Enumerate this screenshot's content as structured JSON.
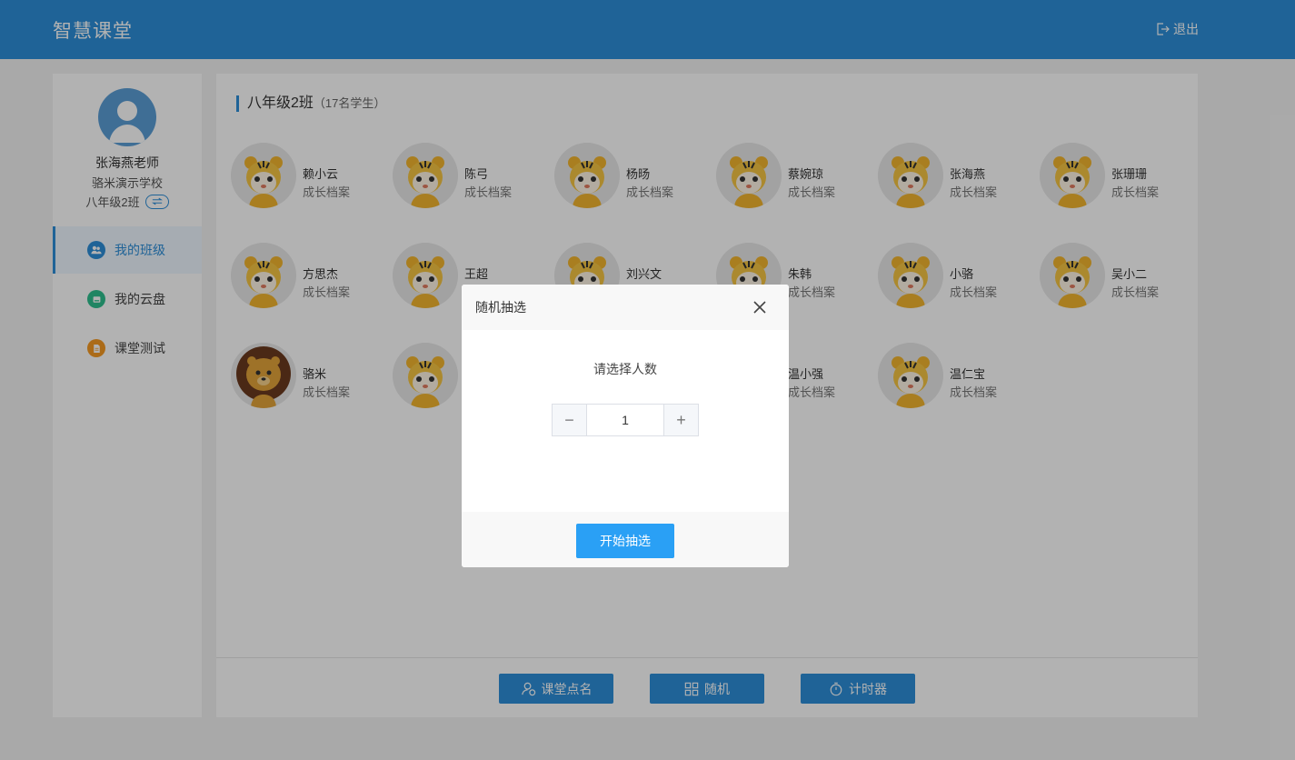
{
  "header": {
    "title": "智慧课堂",
    "logout_label": "退出"
  },
  "sidebar": {
    "teacher_name": "张海燕老师",
    "school_name": "骆米演示学校",
    "class_name": "八年级2班",
    "switch_icon": "swap-icon",
    "nav": [
      {
        "label": "我的班级",
        "icon": "users-icon",
        "color": "#2d8fd9",
        "active": true
      },
      {
        "label": "我的云盘",
        "icon": "cloud-drive-icon",
        "color": "#2fbf8f",
        "active": false
      },
      {
        "label": "课堂测试",
        "icon": "document-icon",
        "color": "#f59a23",
        "active": false
      }
    ]
  },
  "main": {
    "class_title": "八年级2班",
    "student_count": "（17名学生）",
    "students": [
      {
        "name": "赖小云",
        "link": "成长档案",
        "avatar": "tiger"
      },
      {
        "name": "陈弓",
        "link": "成长档案",
        "avatar": "tiger"
      },
      {
        "name": "杨旸",
        "link": "成长档案",
        "avatar": "tiger"
      },
      {
        "name": "蔡婉琼",
        "link": "成长档案",
        "avatar": "tiger"
      },
      {
        "name": "张海燕",
        "link": "成长档案",
        "avatar": "tiger"
      },
      {
        "name": "张珊珊",
        "link": "成长档案",
        "avatar": "tiger"
      },
      {
        "name": "方思杰",
        "link": "成长档案",
        "avatar": "tiger"
      },
      {
        "name": "王超",
        "link": "",
        "avatar": "tiger"
      },
      {
        "name": "刘兴文",
        "link": "",
        "avatar": "tiger"
      },
      {
        "name": "朱韩",
        "link": "成长档案",
        "avatar": "tiger"
      },
      {
        "name": "小骆",
        "link": "成长档案",
        "avatar": "tiger"
      },
      {
        "name": "吴小二",
        "link": "成长档案",
        "avatar": "tiger"
      },
      {
        "name": "骆米",
        "link": "成长档案",
        "avatar": "lion"
      },
      {
        "name": "",
        "link": "",
        "avatar": "tiger"
      },
      {
        "name": "",
        "link": "",
        "avatar": "none"
      },
      {
        "name": "温小强",
        "link": "成长档案",
        "avatar": "none"
      },
      {
        "name": "温仁宝",
        "link": "成长档案",
        "avatar": "tiger"
      }
    ],
    "toolbar": {
      "roll_call": "课堂点名",
      "random": "随机",
      "timer": "计时器"
    }
  },
  "modal": {
    "title": "随机抽选",
    "prompt": "请选择人数",
    "count_value": "1",
    "minus": "−",
    "plus": "+",
    "start_label": "开始抽选"
  },
  "colors": {
    "primary": "#2d8fd9",
    "button": "#2aa0f5"
  }
}
